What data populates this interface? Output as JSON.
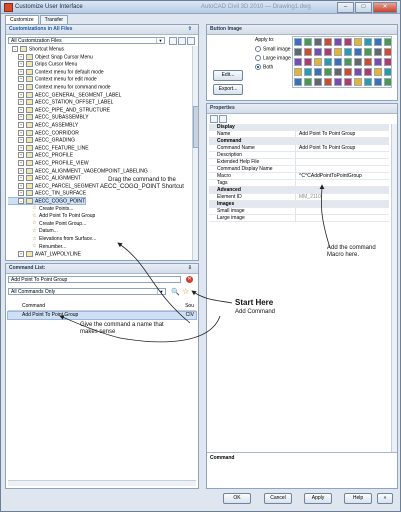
{
  "window": {
    "title": "Customize User Interface",
    "title_faded": "AutoCAD Civil 3D 2010 — Drawing1.dwg",
    "buttons": {
      "minimize": "–",
      "maximize": "□",
      "close": "✕"
    }
  },
  "tabs": [
    {
      "label": "Customize"
    },
    {
      "label": "Transfer"
    }
  ],
  "customizations_panel": {
    "header": "Customizations in All Files",
    "combo_value": "All Customization Files",
    "tree": [
      {
        "label": "Shortcut Menus",
        "icon": "folder-icon",
        "level": 1,
        "expander": "–"
      },
      {
        "label": "Object Snap Cursor Menu",
        "icon": "menu-icon",
        "level": 2,
        "expander": "+"
      },
      {
        "label": "Grips Cursor Menu",
        "icon": "menu-icon",
        "level": 2,
        "expander": "+"
      },
      {
        "label": "Context menu for default mode",
        "icon": "menu-icon",
        "level": 2,
        "expander": "+"
      },
      {
        "label": "Context menu for edit mode",
        "icon": "menu-icon",
        "level": 2,
        "expander": "+"
      },
      {
        "label": "Context menu for command mode",
        "icon": "menu-icon",
        "level": 2,
        "expander": "+"
      },
      {
        "label": "AECC_GENERAL_SEGMENT_LABEL",
        "icon": "menu-icon",
        "level": 2,
        "expander": "+"
      },
      {
        "label": "AECC_STATION_OFFSET_LABEL",
        "icon": "menu-icon",
        "level": 2,
        "expander": "+"
      },
      {
        "label": "AECC_PIPE_AND_STRUCTURE",
        "icon": "menu-icon",
        "level": 2,
        "expander": "+"
      },
      {
        "label": "AECC_SUBASSEMBLY",
        "icon": "menu-icon",
        "level": 2,
        "expander": "+"
      },
      {
        "label": "AECC_ASSEMBLY",
        "icon": "menu-icon",
        "level": 2,
        "expander": "+"
      },
      {
        "label": "AECC_CORRIDOR",
        "icon": "menu-icon",
        "level": 2,
        "expander": "+"
      },
      {
        "label": "AECC_GRADING",
        "icon": "menu-icon",
        "level": 2,
        "expander": "+"
      },
      {
        "label": "AECC_FEATURE_LINE",
        "icon": "menu-icon",
        "level": 2,
        "expander": "+"
      },
      {
        "label": "AECC_PROFILE",
        "icon": "menu-icon",
        "level": 2,
        "expander": "+"
      },
      {
        "label": "AECC_PROFILE_VIEW",
        "icon": "menu-icon",
        "level": 2,
        "expander": "+"
      },
      {
        "label": "AECC_ALIGNMENT_VAGEOMPOINT_LABELING",
        "icon": "menu-icon",
        "level": 2,
        "expander": "+"
      },
      {
        "label": "AECC_ALIGNMENT",
        "icon": "menu-icon",
        "level": 2,
        "expander": "+"
      },
      {
        "label": "AECC_PARCEL_SEGMENT",
        "icon": "menu-icon",
        "level": 2,
        "expander": "+"
      },
      {
        "label": "AECC_TIN_SURFACE",
        "icon": "menu-icon",
        "level": 2,
        "expander": "+"
      },
      {
        "label": "AECC_COGO_POINT",
        "icon": "menu-icon",
        "level": 2,
        "expander": "–",
        "selected": true
      },
      {
        "label": "Create Points...",
        "icon": "star-icon",
        "level": 3
      },
      {
        "label": "Add Point To Point Group",
        "icon": "star-icon",
        "level": 3
      },
      {
        "label": "Create Point Group...",
        "icon": "star-icon",
        "level": 3
      },
      {
        "label": "Datum...",
        "icon": "star-icon",
        "level": 3
      },
      {
        "label": "Elevations from Surface...",
        "icon": "star-icon",
        "level": 3
      },
      {
        "label": "Renumber...",
        "icon": "star-icon",
        "level": 3
      },
      {
        "label": "AVAT_LWPOLYLINE",
        "icon": "menu-icon",
        "level": 2,
        "expander": "+"
      }
    ]
  },
  "command_list": {
    "header": "Command List:",
    "search_value": "Add Point To Point Group",
    "filter_value": "All Commands Only",
    "col_command": "Command",
    "col_source": "Sou",
    "rows": [
      {
        "command": "Add Point To Point Group",
        "source": "CIV"
      }
    ]
  },
  "button_image": {
    "header": "Button Image",
    "apply_to_label": "Apply to:",
    "options": [
      "Small image",
      "Large image",
      "Both"
    ],
    "selected_option": "Both",
    "edit_label": "Edit...",
    "export_label": "Export..."
  },
  "properties": {
    "header": "Properties",
    "categories": [
      {
        "name": "Display",
        "rows": [
          {
            "key": "Name",
            "value": "Add Point To Point Group"
          }
        ]
      },
      {
        "name": "Command",
        "rows": [
          {
            "key": "Command Name",
            "value": "Add Point To Point Group"
          },
          {
            "key": "Description",
            "value": ""
          },
          {
            "key": "Extended Help File",
            "value": ""
          },
          {
            "key": "Command Display Name",
            "value": ""
          },
          {
            "key": "Macro",
            "value": "^C^CAddPointToPointGroup"
          },
          {
            "key": "Tags",
            "value": ""
          }
        ]
      },
      {
        "name": "Advanced",
        "rows": [
          {
            "key": "Element ID",
            "value": "MM_2110",
            "grey": true
          }
        ]
      },
      {
        "name": "Images",
        "rows": [
          {
            "key": "Small image",
            "value": ""
          },
          {
            "key": "Large image",
            "value": ""
          }
        ]
      }
    ],
    "description_title": "Command"
  },
  "footer": {
    "ok": "OK",
    "cancel": "Cancel",
    "apply": "Apply",
    "help": "Help",
    "toggle": "«"
  },
  "annotations": {
    "drag": "Drag the command to the AECC_COGO_POINT Shortcut",
    "start_here": "Start Here",
    "add_command": "Add Command",
    "add_macro": "Add the command Macro here.",
    "give_name": "Give the command a name that makes sense"
  },
  "colors": {
    "accent": "#1a57a8",
    "titlebar": "#b7cbe3",
    "selection": "#cfe0f6"
  }
}
